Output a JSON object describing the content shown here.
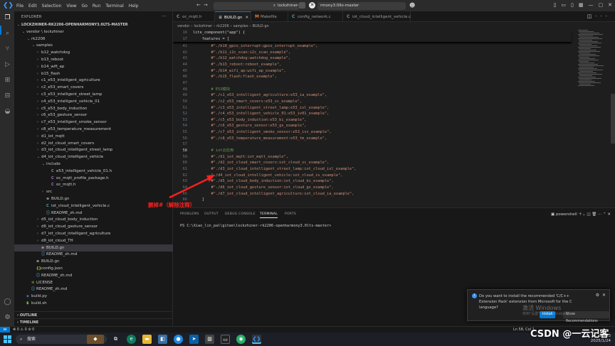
{
  "menu": [
    "File",
    "Edit",
    "Selection",
    "View",
    "Go",
    "Run",
    "Terminal",
    "Help"
  ],
  "command_center": {
    "left_text": "lockzhiner-",
    "right_text": "rmony3.0lts-master"
  },
  "sidebar": {
    "title": "EXPLORER",
    "tree": [
      {
        "label": "LOCKZHINER-RK2206-OPENHARMONY3.0LTS-MASTER",
        "depth": 0,
        "kind": "root"
      },
      {
        "label": "vendor \\ lockzhiner",
        "depth": 1,
        "kind": "folder-open"
      },
      {
        "label": "rk2206",
        "depth": 2,
        "kind": "folder-open"
      },
      {
        "label": "samples",
        "depth": 3,
        "kind": "folder-open"
      },
      {
        "label": "b12_watchdog",
        "depth": 4,
        "kind": "folder"
      },
      {
        "label": "b13_reboot",
        "depth": 4,
        "kind": "folder"
      },
      {
        "label": "b14_wifi_ap",
        "depth": 4,
        "kind": "folder"
      },
      {
        "label": "b15_flash",
        "depth": 4,
        "kind": "folder"
      },
      {
        "label": "c1_e53_intelligent_agriculture",
        "depth": 4,
        "kind": "folder"
      },
      {
        "label": "c2_e53_smart_covers",
        "depth": 4,
        "kind": "folder"
      },
      {
        "label": "c3_e53_intelligent_street_lamp",
        "depth": 4,
        "kind": "folder"
      },
      {
        "label": "c4_e53_intelligent_vehicle_01",
        "depth": 4,
        "kind": "folder"
      },
      {
        "label": "c5_e53_body_induction",
        "depth": 4,
        "kind": "folder"
      },
      {
        "label": "c6_e53_gesture_sensor",
        "depth": 4,
        "kind": "folder"
      },
      {
        "label": "c7_e53_intelligent_smoke_sensor",
        "depth": 4,
        "kind": "folder"
      },
      {
        "label": "c8_e53_temperature_measurement",
        "depth": 4,
        "kind": "folder"
      },
      {
        "label": "d1_iot_mqtt",
        "depth": 4,
        "kind": "folder"
      },
      {
        "label": "d2_iot_cloud_smart_covers",
        "depth": 4,
        "kind": "folder"
      },
      {
        "label": "d3_iot_cloud_intelligent_street_lamp",
        "depth": 4,
        "kind": "folder"
      },
      {
        "label": "d4_iot_cloud_intelligent_vehicle",
        "depth": 4,
        "kind": "folder-open"
      },
      {
        "label": "include",
        "depth": 5,
        "kind": "folder-open"
      },
      {
        "label": "e53_intelligent_vehicle_01.h",
        "depth": 6,
        "kind": "c-header"
      },
      {
        "label": "oc_mqtt_profile_package.h",
        "depth": 6,
        "kind": "c-header"
      },
      {
        "label": "oc_mqtt.h",
        "depth": 6,
        "kind": "c-header"
      },
      {
        "label": "src",
        "depth": 5,
        "kind": "folder"
      },
      {
        "label": "BUILD.gn",
        "depth": 5,
        "kind": "gn"
      },
      {
        "label": "iot_cloud_intelligent_vehicle.c",
        "depth": 5,
        "kind": "c"
      },
      {
        "label": "README_zh.md",
        "depth": 5,
        "kind": "md"
      },
      {
        "label": "d5_iot_cloud_body_induction",
        "depth": 4,
        "kind": "folder"
      },
      {
        "label": "d6_iot_cloud_gesture_sensor",
        "depth": 4,
        "kind": "folder"
      },
      {
        "label": "d7_iot_cloud_intelligent_agriculture",
        "depth": 4,
        "kind": "folder"
      },
      {
        "label": "d8_iot_cloud_TH",
        "depth": 4,
        "kind": "folder"
      },
      {
        "label": "BUILD.gn",
        "depth": 4,
        "kind": "gn",
        "selected": true
      },
      {
        "label": "README_zh.md",
        "depth": 4,
        "kind": "md"
      },
      {
        "label": "BUILD.gn",
        "depth": 3,
        "kind": "gn"
      },
      {
        "label": "config.json",
        "depth": 3,
        "kind": "json"
      },
      {
        "label": "README_zh.md",
        "depth": 3,
        "kind": "md"
      },
      {
        "label": "LICENSE",
        "depth": 2,
        "kind": "license"
      },
      {
        "label": "README_zh.md",
        "depth": 2,
        "kind": "md"
      },
      {
        "label": "build.py",
        "depth": 1,
        "kind": "py"
      },
      {
        "label": "build.sh",
        "depth": 1,
        "kind": "sh"
      }
    ],
    "outline_label": "OUTLINE",
    "timeline_label": "TIMELINE"
  },
  "tabs": [
    {
      "label": "oc_mqtt.h",
      "icon": "C",
      "icon_color": "#a074c4"
    },
    {
      "label": "BUILD.gn",
      "icon": "≡",
      "icon_color": "#cccccc",
      "active": true
    },
    {
      "label": "Makefile",
      "icon": "M",
      "icon_color": "#e37933"
    },
    {
      "label": "config_network.c",
      "icon": "C",
      "icon_color": "#519aba"
    },
    {
      "label": "iot_cloud_intelligent_vehicle.c",
      "icon": "C",
      "icon_color": "#519aba"
    }
  ],
  "breadcrumb": [
    "vendor",
    "lockzhiner",
    "rk2206",
    "samples",
    "BUILD.gn"
  ],
  "sticky": [
    {
      "ln": "16",
      "text": "lite_component(\"app\") {"
    },
    {
      "ln": "17",
      "text": "    features = ["
    }
  ],
  "code": [
    {
      "ln": "41",
      "text": "        #\"./b10_gpio_interrupt:gpio_interrupt_example\",",
      "type": "str"
    },
    {
      "ln": "42",
      "text": "        #\"./b11_i2c_scan:i2c_scan_example\",",
      "type": "str"
    },
    {
      "ln": "43",
      "text": "        #\"./b12_watchdog:watchdog_example\",",
      "type": "str"
    },
    {
      "ln": "44",
      "text": "        #\"./b13_reboot:reboot_example\",",
      "type": "str"
    },
    {
      "ln": "45",
      "text": "        #\"./b14_wifi_ap:wifi_ap_example\",",
      "type": "str"
    },
    {
      "ln": "46",
      "text": "        #\"./b15_flash:flash_example\",",
      "type": "str"
    },
    {
      "ln": "47",
      "text": "",
      "type": "plain"
    },
    {
      "ln": "48",
      "text": "        # E53模块",
      "type": "comment"
    },
    {
      "ln": "49",
      "text": "        #\"./c1_e53_intelligent_agriculture:e53_ia_example\",",
      "type": "str"
    },
    {
      "ln": "50",
      "text": "        #\"./c2_e53_smart_covers:e53_sc_example\",",
      "type": "str"
    },
    {
      "ln": "51",
      "text": "        #\"./c3_e53_intelligent_street_lamp:e53_isl_example\",",
      "type": "str"
    },
    {
      "ln": "52",
      "text": "        #\"./c4_e53_intelligent_vehicle_01:e53_iv01_example\",",
      "type": "str"
    },
    {
      "ln": "53",
      "text": "        #\"./c5_e53_body_induction:e53_bi_example\",",
      "type": "str"
    },
    {
      "ln": "54",
      "text": "        #\"./c6_e53_gesture_sensor:e53_gs_example\",",
      "type": "str"
    },
    {
      "ln": "55",
      "text": "        #\"./c7_e53_intelligent_smoke_sensor:e53_iss_example\",",
      "type": "str"
    },
    {
      "ln": "56",
      "text": "        #\"./c8_e53_temperature_measurement:e53_tm_example\",",
      "type": "str"
    },
    {
      "ln": "57",
      "text": "",
      "type": "plain"
    },
    {
      "ln": "58",
      "text": "        # iot云应用",
      "type": "comment",
      "current": true
    },
    {
      "ln": "59",
      "text": "        #\"./d1_iot_mqtt:iot_mqtt_example\",",
      "type": "str"
    },
    {
      "ln": "60",
      "text": "        #\"./d2_iot_cloud_smart_covers:iot_cloud_sc_example\",",
      "type": "str"
    },
    {
      "ln": "61",
      "text": "        #\"./d3_iot_cloud_intelligent_street_lamp:iot_cloud_isl_example\",",
      "type": "str"
    },
    {
      "ln": "62",
      "text": "        \"./d4_iot_cloud_intelligent_vehicle:iot_cloud_iv_example\",",
      "type": "str"
    },
    {
      "ln": "63",
      "text": "        #\"./d5_iot_cloud_body_induction:iot_cloud_bi_example\",",
      "type": "str"
    },
    {
      "ln": "64",
      "text": "        #\"./d6_iot_cloud_gesture_sensor:iot_cloud_gs_example\",",
      "type": "str"
    },
    {
      "ln": "65",
      "text": "        #\"./d7_iot_cloud_intelligent_agriculture:iot_cloud_ia_example\",",
      "type": "str"
    },
    {
      "ln": "66",
      "text": "    ]",
      "type": "plain"
    }
  ],
  "annotation": {
    "text": "删掉#（解除注释）",
    "color": "#ff2020"
  },
  "panel": {
    "tabs": [
      "PROBLEMS",
      "OUTPUT",
      "DEBUG CONSOLE",
      "TERMINAL",
      "PORTS"
    ],
    "active_tab": "TERMINAL",
    "shell_label": "powershell",
    "prompt": "PS C:\\Xiao_lin_pal\\gitee\\lockzhiner-rk2206-openharmony3.0lts-master>"
  },
  "notification": {
    "text": "Do you want to install the recommended 'C/C++ Extension Pack' extension from Microsoft for the C language?",
    "install_label": "Install",
    "show_label": "Show Recommendations"
  },
  "activation_watermark": {
    "line1": "激活 Windows",
    "line2": "转到\"设置\"以激活 Windows。"
  },
  "statusbar": {
    "left": "⊗ 0 ⚠ 0    ⊘ 0",
    "right": "Ln 58, Col 1"
  },
  "taskbar": {
    "search_placeholder": "搜索",
    "time": "23:53",
    "date": "2025/1/24"
  },
  "csdn_watermark": "CSDN @一云记客",
  "colors": {
    "accent": "#0078d4",
    "string": "#ce9178",
    "comment": "#6a9955",
    "annotation": "#ff2020"
  }
}
